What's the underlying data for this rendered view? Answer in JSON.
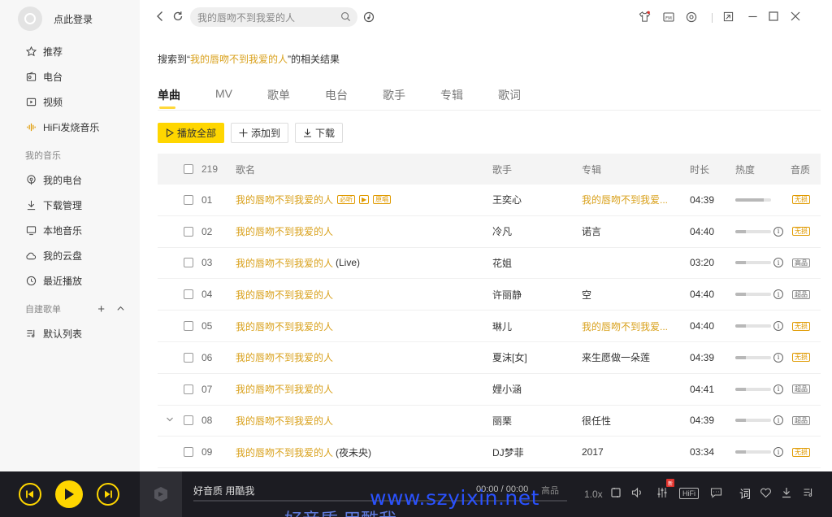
{
  "sidebar": {
    "login_text": "点此登录",
    "nav": [
      {
        "label": "推荐",
        "icon": "star-icon"
      },
      {
        "label": "电台",
        "icon": "radio-icon"
      },
      {
        "label": "视频",
        "icon": "video-icon"
      },
      {
        "label": "HiFi发烧音乐",
        "icon": "soundwave-icon"
      }
    ],
    "my_music_title": "我的音乐",
    "my_music": [
      {
        "label": "我的电台",
        "icon": "radio-signal-icon"
      },
      {
        "label": "下载管理",
        "icon": "download-icon"
      },
      {
        "label": "本地音乐",
        "icon": "monitor-icon"
      },
      {
        "label": "我的云盘",
        "icon": "cloud-icon"
      },
      {
        "label": "最近播放",
        "icon": "clock-icon"
      }
    ],
    "playlist_title": "自建歌单",
    "playlists": [
      {
        "label": "默认列表",
        "icon": "playlist-icon"
      }
    ]
  },
  "search": {
    "value": "我的唇吻不到我爱的人"
  },
  "result": {
    "prefix": "搜索到“",
    "keyword": "我的唇吻不到我爱的人",
    "suffix": "”的相关结果"
  },
  "tabs": [
    "单曲",
    "MV",
    "歌单",
    "电台",
    "歌手",
    "专辑",
    "歌词"
  ],
  "actions": {
    "play_all": "播放全部",
    "add_to": "添加到",
    "download": "下载"
  },
  "table": {
    "count": "219",
    "headers": {
      "title": "歌名",
      "artist": "歌手",
      "album": "专辑",
      "duration": "时长",
      "heat": "热度",
      "quality": "音质"
    },
    "rows": [
      {
        "num": "01",
        "title": "我的唇吻不到我爱的人",
        "suffix": "",
        "tags": [
          "必听",
          "▶",
          "原唱"
        ],
        "artist": "王奕心",
        "album": "我的唇吻不到我爱...",
        "album_link": true,
        "duration": "04:39",
        "heat": 0.8,
        "info": false,
        "quality": "无损",
        "q_gold": true,
        "expand": false
      },
      {
        "num": "02",
        "title": "我的唇吻不到我爱的人",
        "suffix": "",
        "tags": [],
        "artist": "冷凡",
        "album": "诺言",
        "album_link": false,
        "duration": "04:40",
        "heat": 0.3,
        "info": true,
        "quality": "无损",
        "q_gold": true,
        "expand": false
      },
      {
        "num": "03",
        "title": "我的唇吻不到我爱的人",
        "suffix": "(Live)",
        "tags": [],
        "artist": "花姐",
        "album": "",
        "album_link": false,
        "duration": "03:20",
        "heat": 0.3,
        "info": true,
        "quality": "高品",
        "q_gold": false,
        "expand": false
      },
      {
        "num": "04",
        "title": "我的唇吻不到我爱的人",
        "suffix": "",
        "tags": [],
        "artist": "许丽静",
        "album": "空",
        "album_link": false,
        "duration": "04:40",
        "heat": 0.3,
        "info": true,
        "quality": "超品",
        "q_gold": false,
        "expand": false
      },
      {
        "num": "05",
        "title": "我的唇吻不到我爱的人",
        "suffix": "",
        "tags": [],
        "artist": "琳儿",
        "album": "我的唇吻不到我爱...",
        "album_link": true,
        "duration": "04:40",
        "heat": 0.3,
        "info": true,
        "quality": "无损",
        "q_gold": true,
        "expand": false
      },
      {
        "num": "06",
        "title": "我的唇吻不到我爱的人",
        "suffix": "",
        "tags": [],
        "artist": "夏沫[女]",
        "album": "来生愿做一朵莲",
        "album_link": false,
        "duration": "04:39",
        "heat": 0.3,
        "info": true,
        "quality": "无损",
        "q_gold": true,
        "expand": false
      },
      {
        "num": "07",
        "title": "我的唇吻不到我爱的人",
        "suffix": "",
        "tags": [],
        "artist": "娌小涵",
        "album": "",
        "album_link": false,
        "duration": "04:41",
        "heat": 0.3,
        "info": true,
        "quality": "超品",
        "q_gold": false,
        "expand": false
      },
      {
        "num": "08",
        "title": "我的唇吻不到我爱的人",
        "suffix": "",
        "tags": [],
        "artist": "丽栗",
        "album": "很任性",
        "album_link": false,
        "duration": "04:39",
        "heat": 0.3,
        "info": true,
        "quality": "超品",
        "q_gold": false,
        "expand": true
      },
      {
        "num": "09",
        "title": "我的唇吻不到我爱的人",
        "suffix": "(夜未央)",
        "tags": [],
        "artist": "DJ梦菲",
        "album": "2017",
        "album_link": false,
        "duration": "03:34",
        "heat": 0.3,
        "info": true,
        "quality": "无损",
        "q_gold": true,
        "expand": false
      }
    ]
  },
  "player": {
    "song": "好音质 用酷我",
    "time": "00:00 / 00:00",
    "quality": "高品",
    "speed": "1.0x",
    "hifi": "HiFi",
    "lyric_btn": "词",
    "new_badge": "新"
  },
  "watermark": "www.szyixin.net",
  "watermark2": "好音质 用酷我",
  "colors": {
    "accent": "#ffd600",
    "highlight_text": "#d9a11c",
    "player_bg": "#1c1c22"
  }
}
